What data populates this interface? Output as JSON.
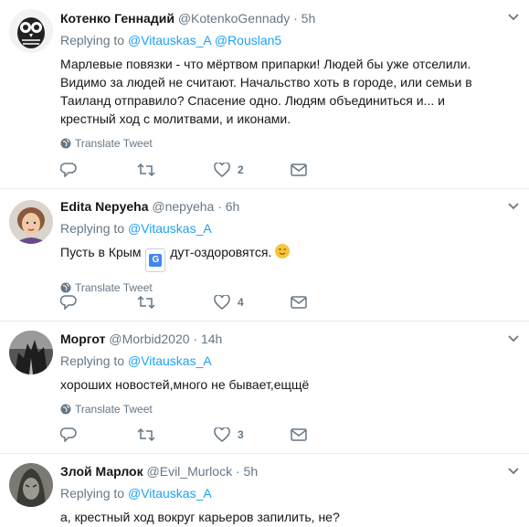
{
  "tweets": [
    {
      "name": "Котенко Геннадий",
      "handle": "@KotenkoGennady",
      "dot": "·",
      "time": "5h",
      "reply_prefix": "Replying to",
      "reply_to_1": "@Vitauskas_A",
      "reply_to_2": "@Rouslan5",
      "text": "Марлевые повязки - что мёртвом припарки! Людей бы уже отселили. Видимо за людей не считают. Начальство хоть в городе, или семьи в Таиланд отправило? Спасение одно. Людям объединиться и... и крестный ход с молитвами, и иконами.",
      "translate": "Translate Tweet",
      "likes": "2"
    },
    {
      "name": "Edita Nepyeha",
      "handle": "@nepyeha",
      "dot": "·",
      "time": "6h",
      "reply_prefix": "Replying to",
      "reply_to_1": "@Vitauskas_A",
      "text_before": "Пусть в Крым",
      "text_badge": "G",
      "text_after": "дут-оздоровятся.",
      "translate": "Translate Tweet",
      "likes": "4"
    },
    {
      "name": "Моргот",
      "handle": "@Morbid2020",
      "dot": "·",
      "time": "14h",
      "reply_prefix": "Replying to",
      "reply_to_1": "@Vitauskas_A",
      "text": "хороших новостей,много не бывает,ещщё",
      "translate": "Translate Tweet",
      "likes": "3"
    },
    {
      "name": "Злой Марлок",
      "handle": "@Evil_Murlock",
      "dot": "·",
      "time": "5h",
      "reply_prefix": "Replying to",
      "reply_to_1": "@Vitauskas_A",
      "text": "а, крестный ход вокруг карьеров запилить, не?"
    }
  ],
  "colors": {
    "link": "#1da1f2",
    "muted": "#657786",
    "border": "#e6ecf0"
  },
  "icons": [
    "globe-icon",
    "reply-icon",
    "retweet-icon",
    "heart-icon",
    "message-icon",
    "chevron-down-icon"
  ]
}
